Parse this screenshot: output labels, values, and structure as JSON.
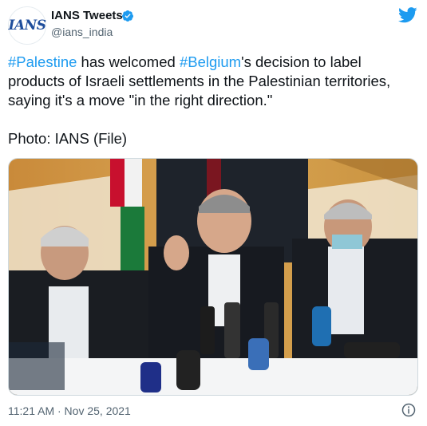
{
  "account": {
    "avatar_text": "IANS",
    "name": "IANS Tweets",
    "handle": "@ians_india"
  },
  "tweet": {
    "tag1": "#Palestine",
    "text1": " has welcomed ",
    "tag2": "#Belgium",
    "text2": "'s decision to label products of Israeli settlements in the Palestinian territories, saying it's a move \"in the right direction.\"",
    "photo_caption": "Photo: IANS (File)"
  },
  "footer": {
    "timestamp": "11:21 AM · Nov 25, 2021"
  },
  "colors": {
    "link": "#1d9bf0",
    "verified": "#1d9bf0",
    "muted": "#536471"
  }
}
